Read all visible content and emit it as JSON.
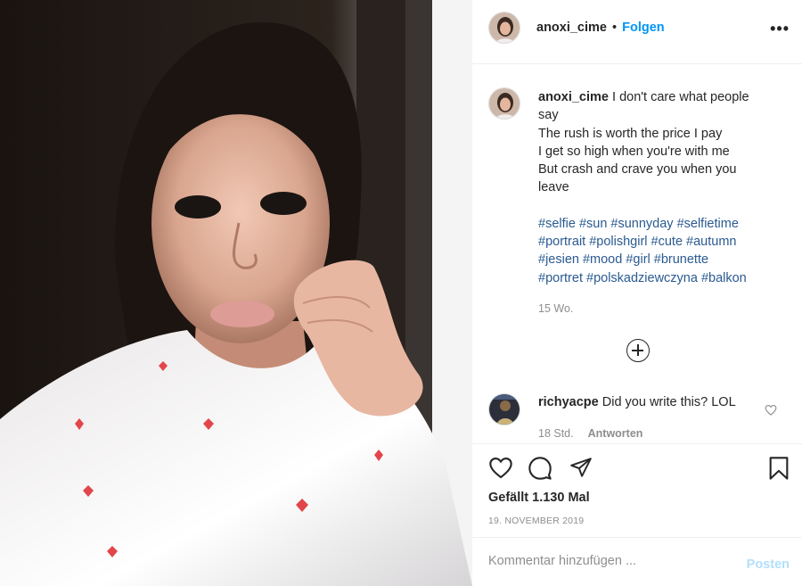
{
  "post_image": {
    "description_icon": "photo-icon"
  },
  "header": {
    "username": "anoxi_cime",
    "separator": "•",
    "follow_label": "Folgen",
    "more_icon": "ellipsis-icon",
    "more_label": "•••"
  },
  "caption": {
    "username": "anoxi_cime",
    "lines": [
      "I don't care what people",
      "say",
      "The rush is worth the price I pay",
      "I get so high when you're with me",
      "But crash and crave you when you",
      "leave"
    ],
    "hashtag_lines": [
      "#selfie #sun #sunnyday #selfietime",
      "#portrait #polishgirl #cute #autumn",
      "#jesien #mood #girl #brunette",
      "#portret #polskadziewczyna #balkon"
    ],
    "time": "15 Wo."
  },
  "load_more_icon": "plus-circle-icon",
  "comment": {
    "username": "richyacpe",
    "text": "Did you write this? LOL",
    "time": "18 Std.",
    "reply_label": "Antworten",
    "like_icon": "heart-outline-icon"
  },
  "actions": {
    "like_icon": "heart-icon",
    "comment_icon": "comment-bubble-icon",
    "share_icon": "paper-plane-icon",
    "save_icon": "bookmark-icon"
  },
  "likes": "Gefällt 1.130 Mal",
  "date": "19. NOVEMBER 2019",
  "add_comment": {
    "placeholder": "Kommentar hinzufügen ...",
    "post_label": "Posten",
    "post_color": "#b2dffc"
  },
  "colors": {
    "follow": "#0095f6",
    "hashtag": "#2a5a91",
    "muted": "#8e8e8e"
  }
}
